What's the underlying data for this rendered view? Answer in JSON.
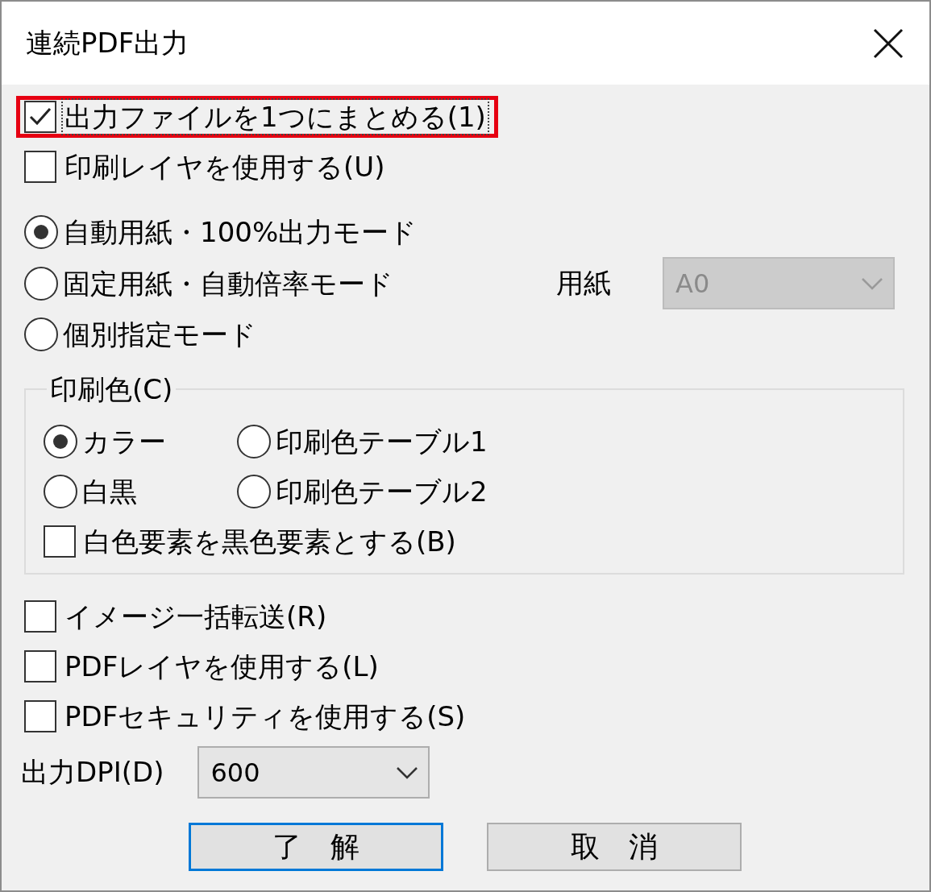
{
  "window": {
    "title": "連続PDF出力"
  },
  "options": [
    {
      "label": "出力ファイルを1つにまとめる(1)",
      "checked": true,
      "highlighted": true,
      "focused": true
    },
    {
      "label": "印刷レイヤを使用する(U)",
      "checked": false
    }
  ],
  "modes": [
    {
      "label": "自動用紙・100%出力モード",
      "selected": true
    },
    {
      "label": "固定用紙・自動倍率モード",
      "selected": false
    },
    {
      "label": "個別指定モード",
      "selected": false
    }
  ],
  "paper": {
    "label": "用紙",
    "value": "A0",
    "disabled": true
  },
  "print_color": {
    "title": "印刷色(C)",
    "choices": [
      {
        "label": "カラー",
        "selected": true
      },
      {
        "label": "印刷色テーブル1",
        "selected": false
      },
      {
        "label": "白黒",
        "selected": false
      },
      {
        "label": "印刷色テーブル2",
        "selected": false
      }
    ],
    "white_as_black": {
      "label": "白色要素を黒色要素とする(B)",
      "checked": false
    }
  },
  "extra_options": [
    {
      "label": "イメージ一括転送(R)",
      "checked": false
    },
    {
      "label": "PDFレイヤを使用する(L)",
      "checked": false
    },
    {
      "label": "PDFセキュリティを使用する(S)",
      "checked": false
    }
  ],
  "dpi": {
    "label": "出力DPI(D)",
    "value": "600",
    "disabled": false
  },
  "buttons": [
    {
      "label": "了　解",
      "default": true
    },
    {
      "label": "取　消",
      "default": false
    }
  ]
}
